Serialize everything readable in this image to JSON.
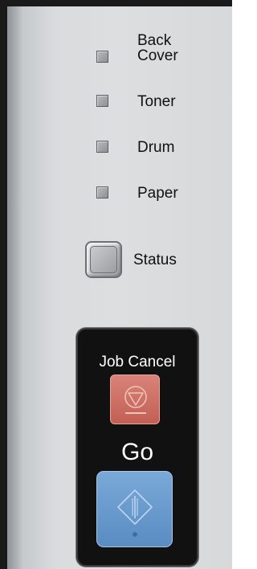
{
  "indicators": [
    {
      "id": "back-cover",
      "label_line1": "Back",
      "label_line2": "Cover"
    },
    {
      "id": "toner",
      "label": "Toner"
    },
    {
      "id": "drum",
      "label": "Drum"
    },
    {
      "id": "paper",
      "label": "Paper"
    }
  ],
  "status": {
    "label": "Status"
  },
  "job_cancel": {
    "label": "Job Cancel",
    "color": "#c86a5f"
  },
  "go": {
    "label": "Go",
    "color": "#6b9bcd"
  }
}
